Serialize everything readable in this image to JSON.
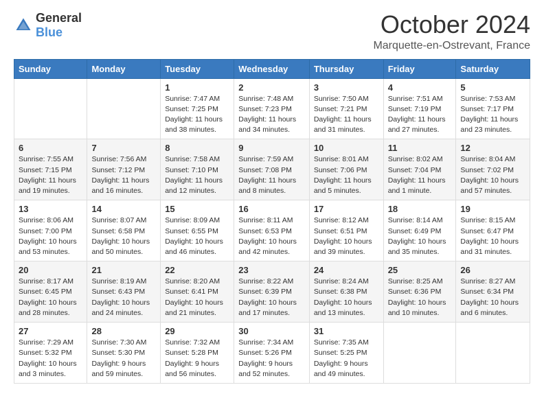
{
  "logo": {
    "general": "General",
    "blue": "Blue"
  },
  "title": "October 2024",
  "location": "Marquette-en-Ostrevant, France",
  "days_of_week": [
    "Sunday",
    "Monday",
    "Tuesday",
    "Wednesday",
    "Thursday",
    "Friday",
    "Saturday"
  ],
  "weeks": [
    [
      {
        "day": "",
        "sunrise": "",
        "sunset": "",
        "daylight": ""
      },
      {
        "day": "",
        "sunrise": "",
        "sunset": "",
        "daylight": ""
      },
      {
        "day": "1",
        "sunrise": "Sunrise: 7:47 AM",
        "sunset": "Sunset: 7:25 PM",
        "daylight": "Daylight: 11 hours and 38 minutes."
      },
      {
        "day": "2",
        "sunrise": "Sunrise: 7:48 AM",
        "sunset": "Sunset: 7:23 PM",
        "daylight": "Daylight: 11 hours and 34 minutes."
      },
      {
        "day": "3",
        "sunrise": "Sunrise: 7:50 AM",
        "sunset": "Sunset: 7:21 PM",
        "daylight": "Daylight: 11 hours and 31 minutes."
      },
      {
        "day": "4",
        "sunrise": "Sunrise: 7:51 AM",
        "sunset": "Sunset: 7:19 PM",
        "daylight": "Daylight: 11 hours and 27 minutes."
      },
      {
        "day": "5",
        "sunrise": "Sunrise: 7:53 AM",
        "sunset": "Sunset: 7:17 PM",
        "daylight": "Daylight: 11 hours and 23 minutes."
      }
    ],
    [
      {
        "day": "6",
        "sunrise": "Sunrise: 7:55 AM",
        "sunset": "Sunset: 7:15 PM",
        "daylight": "Daylight: 11 hours and 19 minutes."
      },
      {
        "day": "7",
        "sunrise": "Sunrise: 7:56 AM",
        "sunset": "Sunset: 7:12 PM",
        "daylight": "Daylight: 11 hours and 16 minutes."
      },
      {
        "day": "8",
        "sunrise": "Sunrise: 7:58 AM",
        "sunset": "Sunset: 7:10 PM",
        "daylight": "Daylight: 11 hours and 12 minutes."
      },
      {
        "day": "9",
        "sunrise": "Sunrise: 7:59 AM",
        "sunset": "Sunset: 7:08 PM",
        "daylight": "Daylight: 11 hours and 8 minutes."
      },
      {
        "day": "10",
        "sunrise": "Sunrise: 8:01 AM",
        "sunset": "Sunset: 7:06 PM",
        "daylight": "Daylight: 11 hours and 5 minutes."
      },
      {
        "day": "11",
        "sunrise": "Sunrise: 8:02 AM",
        "sunset": "Sunset: 7:04 PM",
        "daylight": "Daylight: 11 hours and 1 minute."
      },
      {
        "day": "12",
        "sunrise": "Sunrise: 8:04 AM",
        "sunset": "Sunset: 7:02 PM",
        "daylight": "Daylight: 10 hours and 57 minutes."
      }
    ],
    [
      {
        "day": "13",
        "sunrise": "Sunrise: 8:06 AM",
        "sunset": "Sunset: 7:00 PM",
        "daylight": "Daylight: 10 hours and 53 minutes."
      },
      {
        "day": "14",
        "sunrise": "Sunrise: 8:07 AM",
        "sunset": "Sunset: 6:58 PM",
        "daylight": "Daylight: 10 hours and 50 minutes."
      },
      {
        "day": "15",
        "sunrise": "Sunrise: 8:09 AM",
        "sunset": "Sunset: 6:55 PM",
        "daylight": "Daylight: 10 hours and 46 minutes."
      },
      {
        "day": "16",
        "sunrise": "Sunrise: 8:11 AM",
        "sunset": "Sunset: 6:53 PM",
        "daylight": "Daylight: 10 hours and 42 minutes."
      },
      {
        "day": "17",
        "sunrise": "Sunrise: 8:12 AM",
        "sunset": "Sunset: 6:51 PM",
        "daylight": "Daylight: 10 hours and 39 minutes."
      },
      {
        "day": "18",
        "sunrise": "Sunrise: 8:14 AM",
        "sunset": "Sunset: 6:49 PM",
        "daylight": "Daylight: 10 hours and 35 minutes."
      },
      {
        "day": "19",
        "sunrise": "Sunrise: 8:15 AM",
        "sunset": "Sunset: 6:47 PM",
        "daylight": "Daylight: 10 hours and 31 minutes."
      }
    ],
    [
      {
        "day": "20",
        "sunrise": "Sunrise: 8:17 AM",
        "sunset": "Sunset: 6:45 PM",
        "daylight": "Daylight: 10 hours and 28 minutes."
      },
      {
        "day": "21",
        "sunrise": "Sunrise: 8:19 AM",
        "sunset": "Sunset: 6:43 PM",
        "daylight": "Daylight: 10 hours and 24 minutes."
      },
      {
        "day": "22",
        "sunrise": "Sunrise: 8:20 AM",
        "sunset": "Sunset: 6:41 PM",
        "daylight": "Daylight: 10 hours and 21 minutes."
      },
      {
        "day": "23",
        "sunrise": "Sunrise: 8:22 AM",
        "sunset": "Sunset: 6:39 PM",
        "daylight": "Daylight: 10 hours and 17 minutes."
      },
      {
        "day": "24",
        "sunrise": "Sunrise: 8:24 AM",
        "sunset": "Sunset: 6:38 PM",
        "daylight": "Daylight: 10 hours and 13 minutes."
      },
      {
        "day": "25",
        "sunrise": "Sunrise: 8:25 AM",
        "sunset": "Sunset: 6:36 PM",
        "daylight": "Daylight: 10 hours and 10 minutes."
      },
      {
        "day": "26",
        "sunrise": "Sunrise: 8:27 AM",
        "sunset": "Sunset: 6:34 PM",
        "daylight": "Daylight: 10 hours and 6 minutes."
      }
    ],
    [
      {
        "day": "27",
        "sunrise": "Sunrise: 7:29 AM",
        "sunset": "Sunset: 5:32 PM",
        "daylight": "Daylight: 10 hours and 3 minutes."
      },
      {
        "day": "28",
        "sunrise": "Sunrise: 7:30 AM",
        "sunset": "Sunset: 5:30 PM",
        "daylight": "Daylight: 9 hours and 59 minutes."
      },
      {
        "day": "29",
        "sunrise": "Sunrise: 7:32 AM",
        "sunset": "Sunset: 5:28 PM",
        "daylight": "Daylight: 9 hours and 56 minutes."
      },
      {
        "day": "30",
        "sunrise": "Sunrise: 7:34 AM",
        "sunset": "Sunset: 5:26 PM",
        "daylight": "Daylight: 9 hours and 52 minutes."
      },
      {
        "day": "31",
        "sunrise": "Sunrise: 7:35 AM",
        "sunset": "Sunset: 5:25 PM",
        "daylight": "Daylight: 9 hours and 49 minutes."
      },
      {
        "day": "",
        "sunrise": "",
        "sunset": "",
        "daylight": ""
      },
      {
        "day": "",
        "sunrise": "",
        "sunset": "",
        "daylight": ""
      }
    ]
  ]
}
